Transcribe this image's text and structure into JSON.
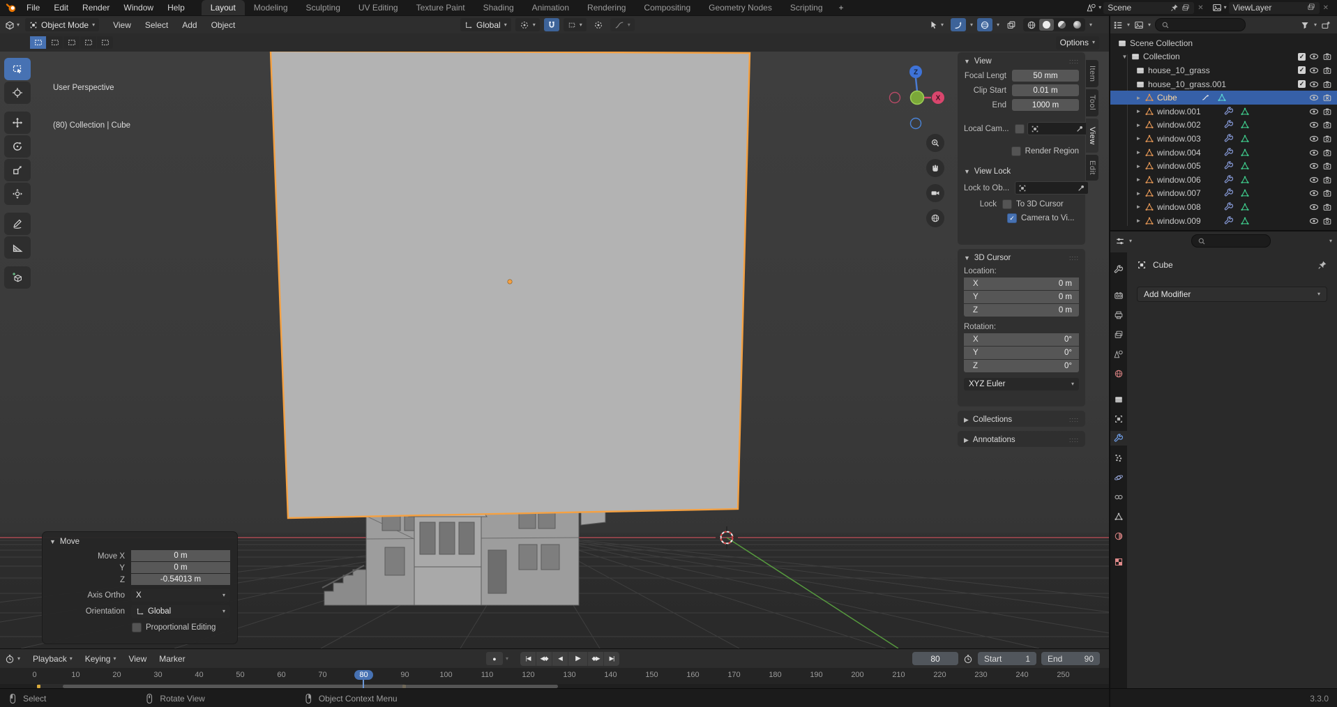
{
  "colors": {
    "accent": "#4772b3",
    "select-outline": "#f5a142",
    "row-select": "#3660a8",
    "axis-x": "#aa4a52",
    "axis-y": "#569a3e",
    "cube-face": "#b3b3b3"
  },
  "topbar": {
    "menus": [
      {
        "label": "File"
      },
      {
        "label": "Edit"
      },
      {
        "label": "Render"
      },
      {
        "label": "Window"
      },
      {
        "label": "Help"
      }
    ],
    "tabs": [
      {
        "label": "Layout",
        "active": true
      },
      {
        "label": "Modeling"
      },
      {
        "label": "Sculpting"
      },
      {
        "label": "UV Editing"
      },
      {
        "label": "Texture Paint"
      },
      {
        "label": "Shading"
      },
      {
        "label": "Animation"
      },
      {
        "label": "Rendering"
      },
      {
        "label": "Compositing"
      },
      {
        "label": "Geometry Nodes"
      },
      {
        "label": "Scripting"
      }
    ],
    "new_tab": "+",
    "scene": {
      "label": "Scene",
      "close": "✕"
    },
    "viewlayer": {
      "label": "ViewLayer",
      "close": "✕"
    }
  },
  "viewport_header": {
    "mode": "Object Mode",
    "menus": [
      {
        "label": "View"
      },
      {
        "label": "Select"
      },
      {
        "label": "Add"
      },
      {
        "label": "Object"
      }
    ],
    "orientation": "Global",
    "options": "Options"
  },
  "viewport": {
    "overlay_line1": "User Perspective",
    "overlay_line2": "(80) Collection | Cube",
    "gizmo_z": "Z",
    "gizmo_x": "X",
    "toolbar": [
      {
        "icon": "#sym-tbox",
        "name": "select-box-tool",
        "active": true
      },
      {
        "icon": "#sym-tcursor",
        "name": "cursor-tool"
      },
      {
        "icon": "#sym-tmove",
        "name": "move-tool",
        "gap": true
      },
      {
        "icon": "#sym-trot",
        "name": "rotate-tool"
      },
      {
        "icon": "#sym-tscale",
        "name": "scale-tool"
      },
      {
        "icon": "#sym-ttrans",
        "name": "transform-tool"
      },
      {
        "icon": "#sym-tpen",
        "name": "annotate-tool",
        "gap": true
      },
      {
        "icon": "#sym-truler",
        "name": "measure-tool"
      },
      {
        "icon": "#sym-tcube",
        "name": "add-cube-tool",
        "gap": true
      }
    ],
    "selmodes": [
      {
        "active": true
      },
      {},
      {},
      {},
      {}
    ],
    "navbtns": [
      {
        "icon": "#sym-zoomin",
        "name": "zoom-button"
      },
      {
        "icon": "#sym-hand",
        "name": "pan-button"
      },
      {
        "icon": "#sym-navcam",
        "name": "camera-view-button"
      },
      {
        "icon": "#sym-wire",
        "name": "toggle-perspective-button"
      }
    ]
  },
  "npanel": {
    "tabs": [
      {
        "label": "Item"
      },
      {
        "label": "Tool"
      },
      {
        "label": "View",
        "active": true
      },
      {
        "label": "Edit"
      }
    ],
    "view": {
      "title": "View",
      "fields": [
        {
          "label": "Focal Lengt",
          "value": "50 mm"
        },
        {
          "label": "Clip Start",
          "value": "0.01 m"
        },
        {
          "label": "End",
          "value": "1000 m"
        }
      ],
      "local_camera_label": "Local Cam...",
      "render_region_label": "Render Region",
      "view_lock_title": "View Lock",
      "lock_to_label": "Lock to Ob...",
      "lock_label": "Lock",
      "to_3d_cursor": "To 3D Cursor",
      "camera_to_view": "Camera to Vi..."
    },
    "cursor3d": {
      "title": "3D Cursor",
      "location_label": "Location:",
      "location": [
        {
          "axis": "X",
          "value": "0 m"
        },
        {
          "axis": "Y",
          "value": "0 m"
        },
        {
          "axis": "Z",
          "value": "0 m"
        }
      ],
      "rotation_label": "Rotation:",
      "rotation": [
        {
          "axis": "X",
          "value": "0°"
        },
        {
          "axis": "Y",
          "value": "0°"
        },
        {
          "axis": "Z",
          "value": "0°"
        }
      ],
      "euler": "XYZ Euler"
    },
    "collections_title": "Collections",
    "annotations_title": "Annotations"
  },
  "move_panel": {
    "title": "Move",
    "fields": [
      {
        "label": "Move X",
        "value": "0 m"
      },
      {
        "label": "Y",
        "value": "0 m"
      },
      {
        "label": "Z",
        "value": "-0.54013 m"
      }
    ],
    "axis_label": "Axis Ortho",
    "axis_value": "X",
    "orientation_label": "Orientation",
    "orientation_value": "Global",
    "proportional_label": "Proportional Editing"
  },
  "outliner": {
    "rows": [
      {
        "label": "Scene Collection",
        "icon": "box",
        "depth": "d0"
      },
      {
        "label": "Collection",
        "icon": "box",
        "depth": "d1",
        "open": true,
        "check": true,
        "eye": true,
        "cam": true
      },
      {
        "label": "house_10_grass",
        "icon": "box",
        "depth": "d2",
        "check": true,
        "eye": true,
        "cam": true
      },
      {
        "label": "house_10_grass.001",
        "icon": "box",
        "depth": "d2",
        "check": true,
        "eye": true,
        "cam": true
      },
      {
        "label": "Cube",
        "icon": "mesh",
        "depth": "d2",
        "closed": true,
        "sel": "sel",
        "anim": true,
        "meshdata": "cyan",
        "eye": true,
        "camx": true
      },
      {
        "label": "window.001",
        "icon": "mesh",
        "depth": "d2",
        "closed": true,
        "wrench": true,
        "meshdata": "green",
        "shift": "shift",
        "eye": true,
        "cam": true
      },
      {
        "label": "window.002",
        "icon": "mesh",
        "depth": "d2",
        "closed": true,
        "wrench": true,
        "meshdata": "green",
        "shift": "shift",
        "eye": true,
        "cam": true
      },
      {
        "label": "window.003",
        "icon": "mesh",
        "depth": "d2",
        "closed": true,
        "wrench": true,
        "meshdata": "green",
        "shift": "shift",
        "eye": true,
        "cam": true
      },
      {
        "label": "window.004",
        "icon": "mesh",
        "depth": "d2",
        "closed": true,
        "wrench": true,
        "meshdata": "green",
        "shift": "shift",
        "eye": true,
        "cam": true
      },
      {
        "label": "window.005",
        "icon": "mesh",
        "depth": "d2",
        "closed": true,
        "wrench": true,
        "meshdata": "green",
        "shift": "shift",
        "eye": true,
        "cam": true
      },
      {
        "label": "window.006",
        "icon": "mesh",
        "depth": "d2",
        "closed": true,
        "wrench": true,
        "meshdata": "green",
        "shift": "shift",
        "eye": true,
        "cam": true
      },
      {
        "label": "window.007",
        "icon": "mesh",
        "depth": "d2",
        "closed": true,
        "wrench": true,
        "meshdata": "green",
        "shift": "shift",
        "eye": true,
        "cam": true
      },
      {
        "label": "window.008",
        "icon": "mesh",
        "depth": "d2",
        "closed": true,
        "wrench": true,
        "meshdata": "green",
        "shift": "shift",
        "eye": true,
        "cam": true
      },
      {
        "label": "window.009",
        "icon": "mesh",
        "depth": "d2",
        "closed": true,
        "wrench": true,
        "meshdata": "green",
        "shift": "shift",
        "eye": true,
        "cam": true
      }
    ]
  },
  "properties": {
    "breadcrumb": "Cube",
    "add_modifier": "Add Modifier",
    "tabs": [
      {
        "icon": "#sym-wrench",
        "name": "tab-tool"
      },
      {
        "icon": "#sym-camback",
        "name": "tab-render",
        "gap": true
      },
      {
        "icon": "#sym-printer",
        "name": "tab-output"
      },
      {
        "icon": "#sym-photos",
        "name": "tab-view-layer"
      },
      {
        "icon": "#sym-scene",
        "name": "tab-scene"
      },
      {
        "icon": "#sym-wire",
        "name": "tab-world",
        "cls": "red"
      },
      {
        "icon": "#sym-box",
        "name": "tab-collection",
        "gap": true
      },
      {
        "icon": "#sym-objsq",
        "name": "tab-object",
        "cls": "orange"
      },
      {
        "icon": "#sym-wrench",
        "name": "tab-modifiers",
        "cls": "blue",
        "active": true
      },
      {
        "icon": "#sym-part",
        "name": "tab-particles"
      },
      {
        "icon": "#sym-phys",
        "name": "tab-physics",
        "cls": "bluegray"
      },
      {
        "icon": "#sym-con",
        "name": "tab-constraints"
      },
      {
        "icon": "#sym-mesh",
        "name": "tab-object-data",
        "cls": "green"
      },
      {
        "icon": "#sym-mat",
        "name": "tab-material",
        "cls": "red"
      },
      {
        "icon": "#sym-tex",
        "name": "tab-texture",
        "cls": "pink",
        "gap": true
      }
    ]
  },
  "timeline": {
    "menus": [
      {
        "label": "Playback",
        "chev": true
      },
      {
        "label": "Keying",
        "chev": true
      },
      {
        "label": "View"
      },
      {
        "label": "Marker"
      }
    ],
    "frame": "80",
    "start_label": "Start",
    "start": "1",
    "end_label": "End",
    "end": "90",
    "play": {
      "jump_start": "|◀",
      "prev_key": "◀◆",
      "play_rev": "◀",
      "play": "▶",
      "next_key": "◆▶",
      "jump_end": "▶|"
    },
    "ruler": [
      {
        "n": "0"
      },
      {
        "n": "10"
      },
      {
        "n": "20"
      },
      {
        "n": "30"
      },
      {
        "n": "40"
      },
      {
        "n": "50"
      },
      {
        "n": "60"
      },
      {
        "n": "70"
      },
      {
        "n": "80",
        "cur": "cur"
      },
      {
        "n": "90"
      },
      {
        "n": "100"
      },
      {
        "n": "110"
      },
      {
        "n": "120"
      },
      {
        "n": "130"
      },
      {
        "n": "140"
      },
      {
        "n": "150"
      },
      {
        "n": "160"
      },
      {
        "n": "170"
      },
      {
        "n": "180"
      },
      {
        "n": "190"
      },
      {
        "n": "200"
      },
      {
        "n": "210"
      },
      {
        "n": "220"
      },
      {
        "n": "230"
      },
      {
        "n": "240"
      },
      {
        "n": "250"
      }
    ]
  },
  "statusbar": {
    "items": [
      {
        "btn": "#sym-ml",
        "name": "left-mouse",
        "label": "Select"
      },
      {
        "btn": "#sym-mm",
        "name": "middle-mouse",
        "label": "Rotate View"
      },
      {
        "btn": "#sym-mr",
        "name": "right-mouse",
        "label": "Object Context Menu"
      }
    ],
    "version": "3.3.0"
  }
}
